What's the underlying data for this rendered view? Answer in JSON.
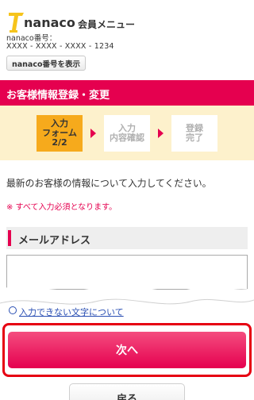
{
  "header": {
    "logo_text": "nanaco",
    "menu_title": "会員メニュー",
    "number_label": "nanaco番号：",
    "number_value": "XXXX - XXXX - XXXX - 1234",
    "show_number_button": "nanaco番号を表示"
  },
  "page": {
    "title": "お客様情報登録・変更"
  },
  "steps": [
    {
      "line1": "入力",
      "line2": "フォーム",
      "line3": "2/2",
      "state": "active"
    },
    {
      "line1": "入力",
      "line2": "内容確認",
      "state": "inactive"
    },
    {
      "line1": "登録",
      "line2": "完了",
      "state": "inactive"
    }
  ],
  "form": {
    "intro": "最新のお客様の情報について入力してください。",
    "required_note": "※ すべて入力必須となります。",
    "email_label": "メールアドレス",
    "email_value": "",
    "hint_link": "入力できない文字について"
  },
  "buttons": {
    "next": "次へ",
    "back": "戻る"
  },
  "colors": {
    "brand_pink": "#e5004f",
    "step_active": "#f6aa1c",
    "step_background": "#fdf1cc",
    "highlight_border": "#e60012"
  }
}
